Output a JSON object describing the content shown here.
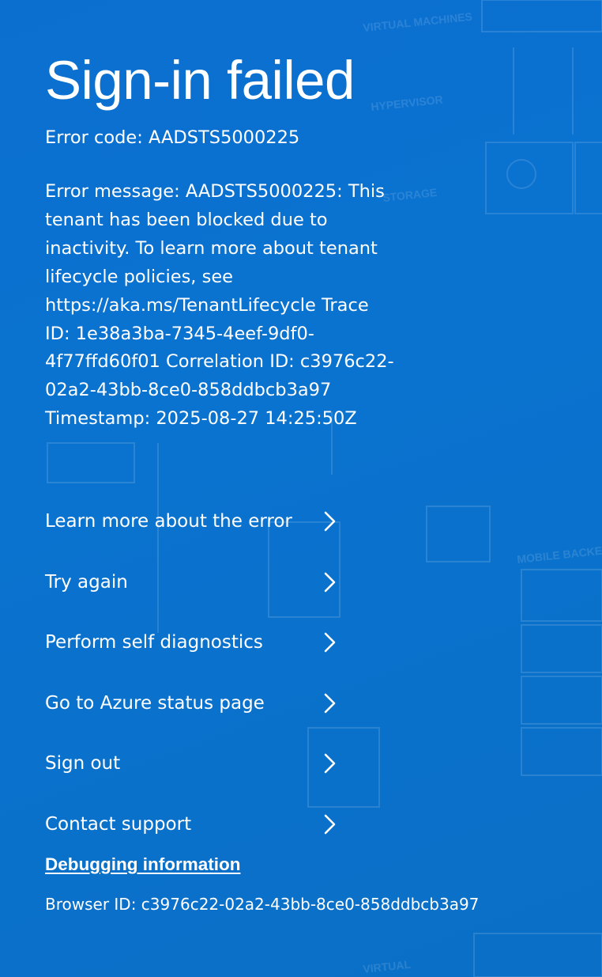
{
  "page": {
    "title": "Sign-in failed",
    "error_code": "Error code: AADSTS5000225",
    "error_message_lines": [
      "Error message: AADSTS5000225: This",
      "tenant has been blocked due to",
      "inactivity. To learn more about tenant",
      "lifecycle policies, see",
      "https://aka.ms/TenantLifecycle Trace",
      "ID: 1e38a3ba-7345-4eef-9df0-",
      "4f77ffd60f01 Correlation ID: c3976c22-",
      "02a2-43bb-8ce0-858ddbcb3a97",
      "Timestamp: 2025-08-27 14:25:50Z"
    ]
  },
  "actions": [
    {
      "label": "Learn more about the error",
      "icon": "chevron-right-icon"
    },
    {
      "label": "Try again",
      "icon": "chevron-right-icon"
    },
    {
      "label": "Perform self diagnostics",
      "icon": "chevron-right-icon"
    },
    {
      "label": "Go to Azure status page",
      "icon": "chevron-right-icon"
    },
    {
      "label": "Sign out",
      "icon": "chevron-right-icon"
    },
    {
      "label": "Contact support",
      "icon": "chevron-right-icon"
    }
  ],
  "debugging": {
    "link_label": "Debugging information",
    "browser_id": "Browser ID: c3976c22-02a2-43bb-8ce0-858ddbcb3a97"
  },
  "colors": {
    "background": "#0a72cf",
    "text": "#ffffff"
  }
}
